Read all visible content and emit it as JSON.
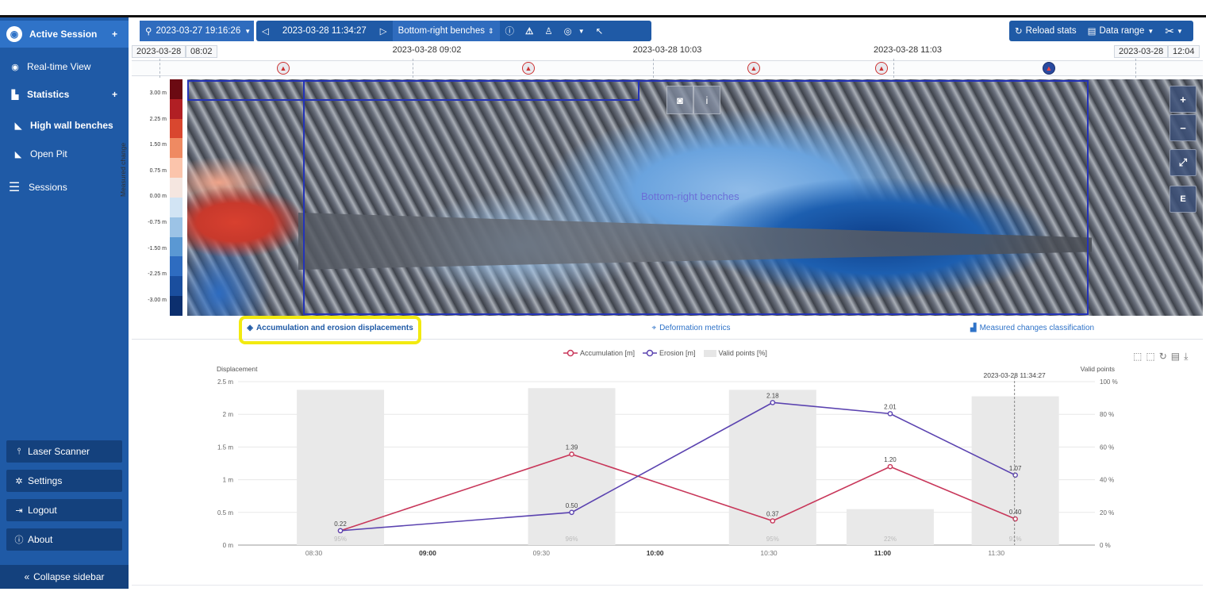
{
  "sidebar": {
    "active_session": "Active Session",
    "realtime": "Real-time View",
    "statistics": "Statistics",
    "high_wall": "High wall benches",
    "open_pit": "Open Pit",
    "sessions": "Sessions",
    "laser_scanner": "Laser Scanner",
    "settings": "Settings",
    "logout": "Logout",
    "about": "About",
    "collapse": "Collapse sidebar"
  },
  "toolbar": {
    "start_date": "2023-03-27 19:16:26",
    "current_date": "2023-03-28 11:34:27",
    "area": "Bottom-right benches",
    "reload": "Reload stats",
    "data_range": "Data range"
  },
  "timeline": {
    "left_date": "2023-03-28",
    "left_time": "08:02",
    "right_date": "2023-03-28",
    "right_time": "12:04",
    "labels": [
      "2023-03-28 09:02",
      "2023-03-28 10:03",
      "2023-03-28 11:03"
    ]
  },
  "map": {
    "region_label": "Bottom-right benches",
    "colorbar_title": "Measured change",
    "colorbar_ticks": [
      "3.00 m",
      "2.25 m",
      "1.50 m",
      "0.75 m",
      "0.00 m",
      "-0.75 m",
      "-1.50 m",
      "-2.25 m",
      "-3.00 m"
    ],
    "colorbar_colors": [
      "#6b0a12",
      "#b11f24",
      "#d9472f",
      "#ef8a62",
      "#fbc4ab",
      "#f5e6e0",
      "#d2e4f4",
      "#9cc3e6",
      "#5a98d3",
      "#2e6cc0",
      "#1a4e9e",
      "#0c2f6e"
    ]
  },
  "tabs": {
    "accumulation": "Accumulation and erosion displacements",
    "deformation": "Deformation metrics",
    "classification": "Measured changes classification"
  },
  "chart_data": {
    "type": "line",
    "title": "",
    "ylabel": "Displacement",
    "y2label": "Valid points",
    "x_ticks": [
      "08:30",
      "09:00",
      "09:30",
      "10:00",
      "10:30",
      "11:00",
      "11:30"
    ],
    "y_ticks": [
      "0 m",
      "0.5 m",
      "1 m",
      "1.5 m",
      "2 m",
      "2.5 m"
    ],
    "y2_ticks": [
      "0 %",
      "20 %",
      "40 %",
      "60 %",
      "80 %",
      "100 %"
    ],
    "ylim": [
      0,
      2.5
    ],
    "y2lim": [
      0,
      100
    ],
    "x_time": [
      "08:37",
      "09:38",
      "10:31",
      "11:02",
      "11:35"
    ],
    "series": [
      {
        "name": "Accumulation [m]",
        "color": "#c8375a",
        "values": [
          0.22,
          1.39,
          0.37,
          1.2,
          0.4
        ]
      },
      {
        "name": "Erosion [m]",
        "color": "#5b43b0",
        "values": [
          0.22,
          0.5,
          2.18,
          2.01,
          1.07
        ]
      },
      {
        "name": "Valid points [%]",
        "color": "#e6e6e6",
        "values": [
          95,
          96,
          95,
          22,
          91
        ]
      }
    ],
    "bar_labels": [
      "95%",
      "96%",
      "95%",
      "22%",
      "91%"
    ],
    "value_labels_acc": [
      "0.22",
      "1.39",
      "0.37",
      "1.20",
      "0.40"
    ],
    "value_labels_ero": [
      "0.50",
      "2.18",
      "2.01",
      "1.07"
    ],
    "cursor_label": "2023-03-28 11:34:27"
  }
}
